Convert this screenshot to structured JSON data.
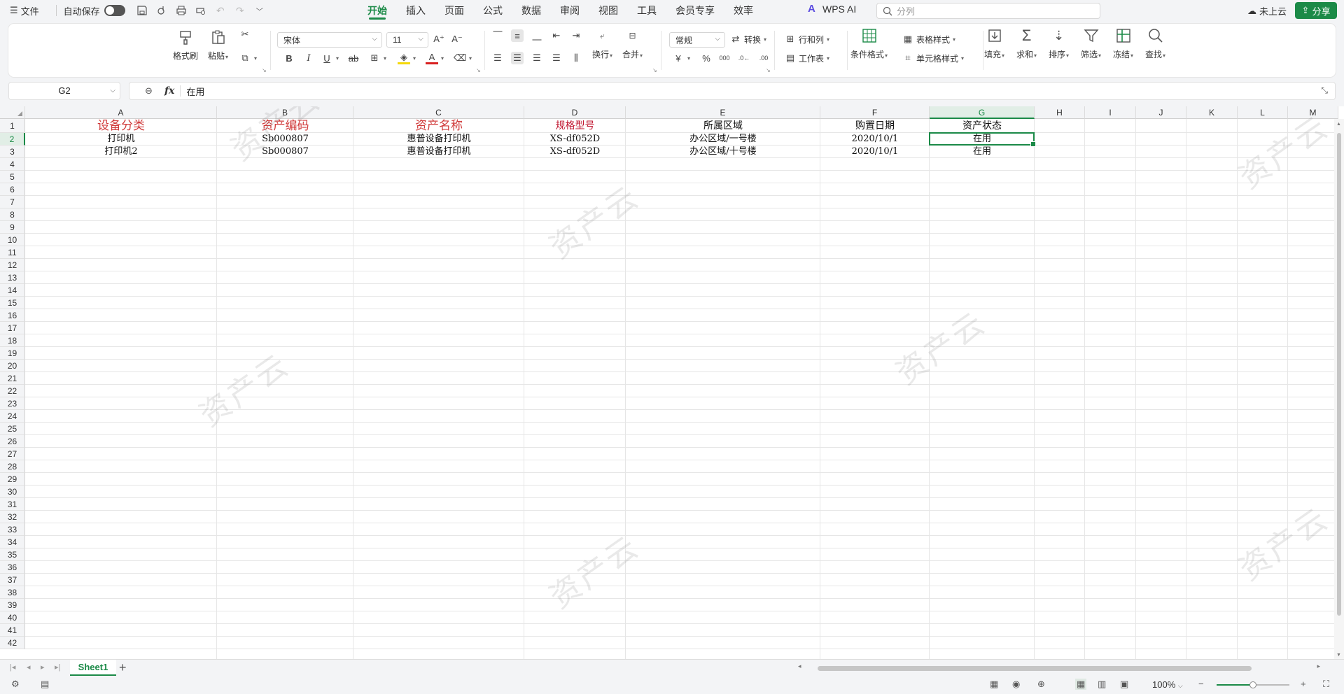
{
  "topbar": {
    "file_menu": "文件",
    "autosave_label": "自动保存",
    "tabs": [
      {
        "label": "开始",
        "active": true
      },
      {
        "label": "插入",
        "active": false
      },
      {
        "label": "页面",
        "active": false
      },
      {
        "label": "公式",
        "active": false
      },
      {
        "label": "数据",
        "active": false
      },
      {
        "label": "审阅",
        "active": false
      },
      {
        "label": "视图",
        "active": false
      },
      {
        "label": "工具",
        "active": false
      },
      {
        "label": "会员专享",
        "active": false
      },
      {
        "label": "效率",
        "active": false
      }
    ],
    "wps_ai": "WPS AI",
    "search_placeholder": "分列",
    "cloud_status": "未上云",
    "share_label": "分享"
  },
  "ribbon": {
    "format_painter": "格式刷",
    "paste": "粘贴",
    "font_name": "宋体",
    "font_size": "11",
    "wrap": "换行",
    "merge": "合并",
    "number_format": "常规",
    "convert": "转换",
    "rows_cols": "行和列",
    "worksheet": "工作表",
    "conditional_format": "条件格式",
    "table_style": "表格样式",
    "cell_style": "单元格样式",
    "fill": "填充",
    "sum": "求和",
    "sort": "排序",
    "filter": "筛选",
    "freeze": "冻结",
    "find": "查找",
    "accent_color": "#1b8a47"
  },
  "formula_bar": {
    "name_box": "G2",
    "fx_label": "fx",
    "value": "在用"
  },
  "sheet": {
    "columns": [
      "A",
      "B",
      "C",
      "D",
      "E",
      "F",
      "G",
      "H",
      "I",
      "J",
      "K",
      "L",
      "M"
    ],
    "selected_column": "G",
    "selected_row": 2,
    "row_count": 42,
    "header_row": [
      {
        "text": "设备分类",
        "color": "#d03a3a"
      },
      {
        "text": "资产编码",
        "color": "#d03a3a"
      },
      {
        "text": "资产名称",
        "color": "#d03a3a"
      },
      {
        "text": "规格型号",
        "color": "#c0152f"
      },
      {
        "text": "所属区域",
        "color": "#111111"
      },
      {
        "text": "购置日期",
        "color": "#111111"
      },
      {
        "text": "资产状态",
        "color": "#111111"
      }
    ],
    "data_rows": [
      [
        "打印机",
        "Sb000807",
        "惠普设备打印机",
        "XS-df052D",
        "办公区域/一号楼",
        "2020/10/1",
        "在用"
      ],
      [
        "打印机2",
        "Sb000807",
        "惠普设备打印机",
        "XS-df052D",
        "办公区域/十号楼",
        "2020/10/1",
        "在用"
      ]
    ],
    "watermark": "资产云"
  },
  "sheet_tabs": {
    "sheets": [
      "Sheet1"
    ],
    "active": "Sheet1"
  },
  "status_bar": {
    "zoom": "100%",
    "zoom_level": 1.0
  }
}
